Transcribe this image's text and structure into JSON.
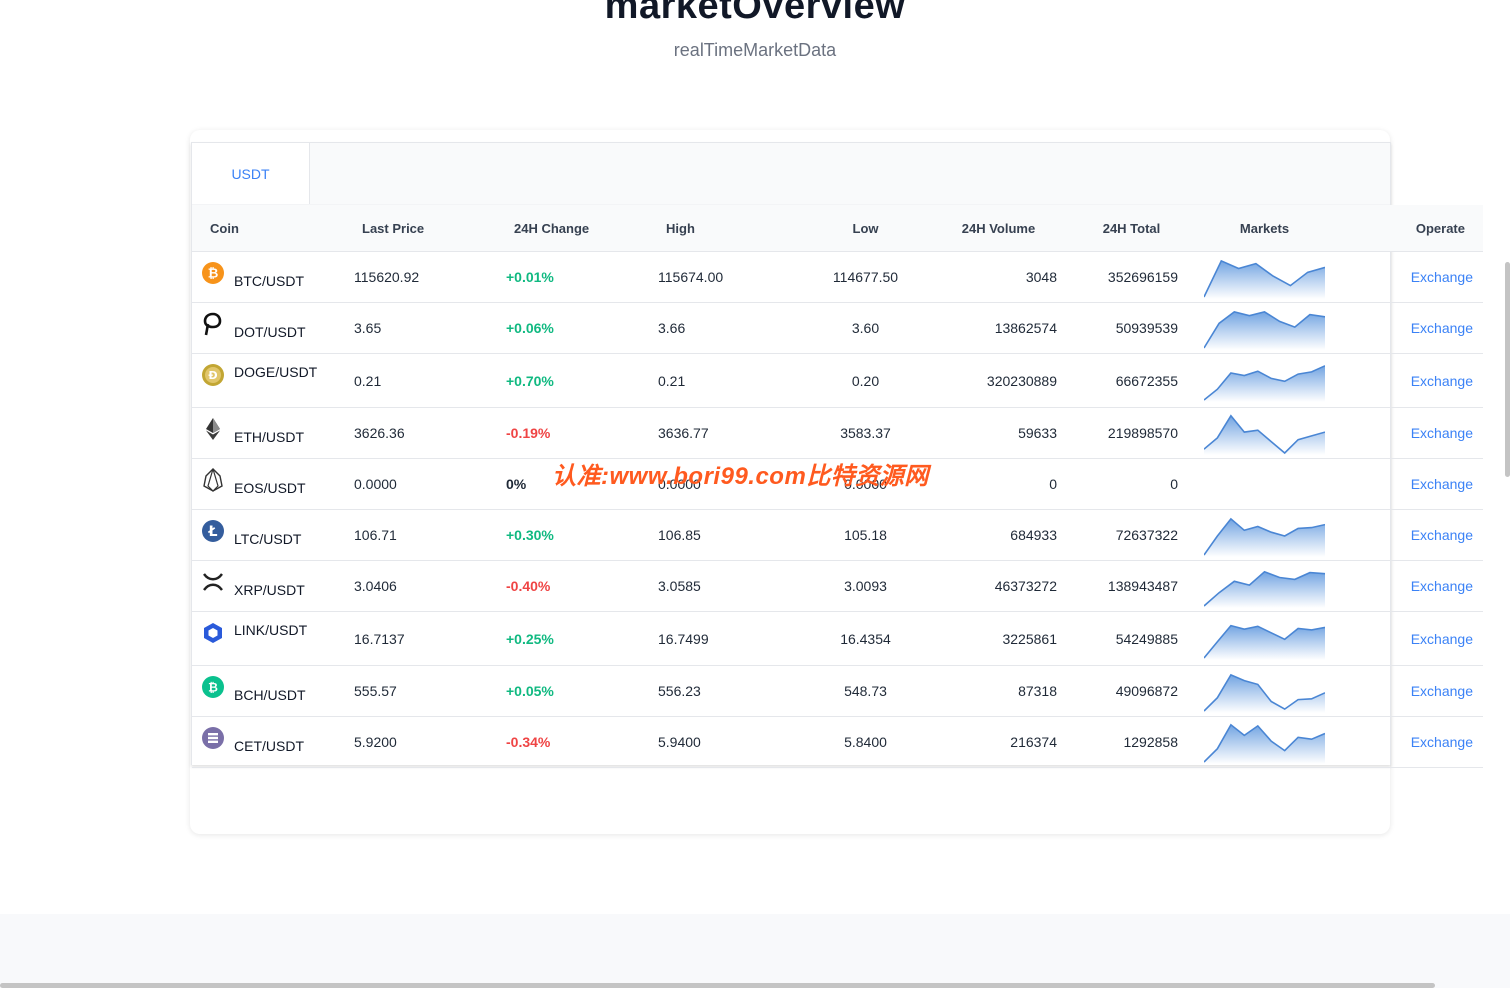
{
  "header": {
    "title": "marketOverview",
    "subtitle": "realTimeMarketData"
  },
  "tabs": [
    {
      "label": "USDT",
      "active": true
    }
  ],
  "columns": [
    "Coin",
    "Last Price",
    "24H Change",
    "High",
    "Low",
    "24H Volume",
    "24H Total",
    "Markets",
    "Operate"
  ],
  "rows": [
    {
      "pair": "BTC/USDT",
      "icon": "bitcoin-icon",
      "last": "115620.92",
      "change": "+0.01%",
      "dir": "up",
      "high": "115674.00",
      "low": "114677.50",
      "volume": "3048",
      "total": "352696159",
      "action": "Exchange",
      "spark": [
        0.0,
        0.95,
        0.75,
        0.88,
        0.55,
        0.3,
        0.65,
        0.78
      ]
    },
    {
      "pair": "DOT/USDT",
      "icon": "polkadot-icon",
      "last": "3.65",
      "change": "+0.06%",
      "dir": "up",
      "high": "3.66",
      "low": "3.60",
      "volume": "13862574",
      "total": "50939539",
      "action": "Exchange",
      "spark": [
        0.0,
        0.65,
        0.95,
        0.85,
        0.95,
        0.7,
        0.55,
        0.88,
        0.82
      ]
    },
    {
      "pair": "DOGE/USDT",
      "icon": "dogecoin-icon",
      "last": "0.21",
      "change": "+0.70%",
      "dir": "up",
      "high": "0.21",
      "low": "0.20",
      "volume": "320230889",
      "total": "66672355",
      "action": "Exchange",
      "spark": [
        0.0,
        0.3,
        0.75,
        0.68,
        0.8,
        0.6,
        0.52,
        0.72,
        0.78,
        0.95
      ]
    },
    {
      "pair": "ETH/USDT",
      "icon": "ethereum-icon",
      "last": "3626.36",
      "change": "-0.19%",
      "dir": "down",
      "high": "3636.77",
      "low": "3583.37",
      "volume": "59633",
      "total": "219898570",
      "action": "Exchange",
      "spark": [
        0.1,
        0.4,
        0.98,
        0.55,
        0.6,
        0.3,
        0.0,
        0.35,
        0.45,
        0.55
      ]
    },
    {
      "pair": "EOS/USDT",
      "icon": "eos-icon",
      "last": "0.0000",
      "change": "0%",
      "dir": "flat",
      "high": "0.0000",
      "low": "0.0000",
      "volume": "0",
      "total": "0",
      "action": "Exchange",
      "spark": []
    },
    {
      "pair": "LTC/USDT",
      "icon": "litecoin-icon",
      "last": "106.71",
      "change": "+0.30%",
      "dir": "up",
      "high": "106.85",
      "low": "105.18",
      "volume": "684933",
      "total": "72637322",
      "action": "Exchange",
      "spark": [
        0.0,
        0.5,
        0.95,
        0.65,
        0.75,
        0.6,
        0.5,
        0.7,
        0.72,
        0.8
      ]
    },
    {
      "pair": "XRP/USDT",
      "icon": "xrp-icon",
      "last": "3.0406",
      "change": "-0.40%",
      "dir": "down",
      "high": "3.0585",
      "low": "3.0093",
      "volume": "46373272",
      "total": "138943487",
      "action": "Exchange",
      "spark": [
        0.0,
        0.35,
        0.65,
        0.55,
        0.9,
        0.75,
        0.7,
        0.88,
        0.85
      ]
    },
    {
      "pair": "LINK/USDT",
      "icon": "chainlink-icon",
      "last": "16.7137",
      "change": "+0.25%",
      "dir": "up",
      "high": "16.7499",
      "low": "16.4354",
      "volume": "3225861",
      "total": "54249885",
      "action": "Exchange",
      "spark": [
        0.0,
        0.45,
        0.9,
        0.8,
        0.88,
        0.7,
        0.52,
        0.82,
        0.78,
        0.85
      ]
    },
    {
      "pair": "BCH/USDT",
      "icon": "bitcoin-cash-icon",
      "last": "555.57",
      "change": "+0.05%",
      "dir": "up",
      "high": "556.23",
      "low": "548.73",
      "volume": "87318",
      "total": "49096872",
      "action": "Exchange",
      "spark": [
        0.0,
        0.35,
        0.95,
        0.8,
        0.7,
        0.25,
        0.05,
        0.3,
        0.32,
        0.48
      ]
    },
    {
      "pair": "CET/USDT",
      "icon": "coinex-icon",
      "last": "5.9200",
      "change": "-0.34%",
      "dir": "down",
      "high": "5.9400",
      "low": "5.8400",
      "volume": "216374",
      "total": "1292858",
      "action": "Exchange",
      "spark": [
        0.0,
        0.35,
        0.98,
        0.7,
        0.95,
        0.55,
        0.3,
        0.65,
        0.6,
        0.75
      ]
    }
  ],
  "watermark": "认准:www.bori99.com比特资源网",
  "colors": {
    "accent": "#3b82f6",
    "up": "#10b981",
    "down": "#ef4444",
    "spark_line": "#4a86d4",
    "spark_fill_top": "#6a9fe0"
  }
}
